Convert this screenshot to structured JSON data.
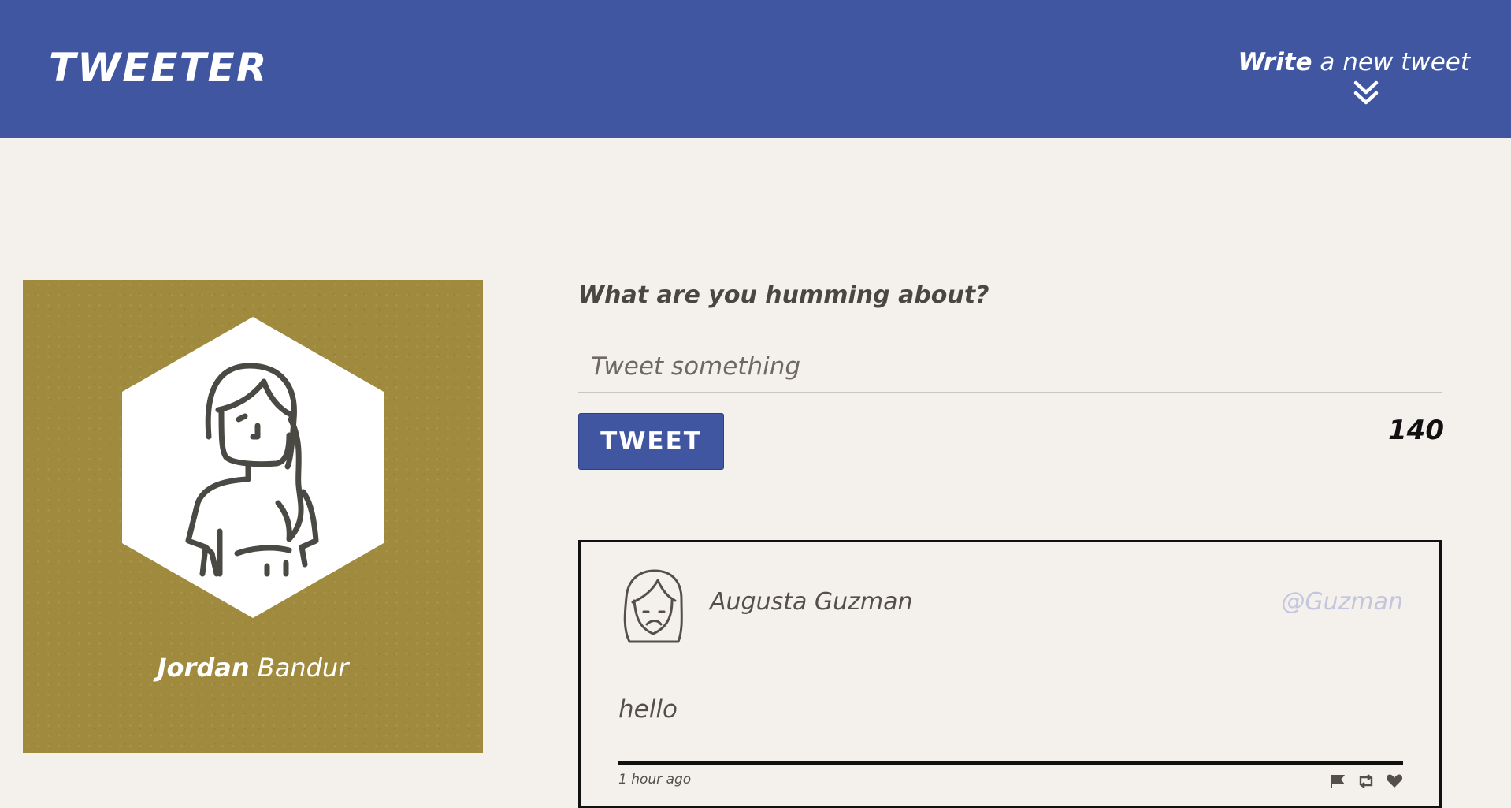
{
  "header": {
    "brand": "TWEETER",
    "compose_toggle_bold": "Write",
    "compose_toggle_rest": " a new tweet",
    "compose_toggle_icon": "double-chevron-down-icon"
  },
  "profile": {
    "first_name": "Jordan",
    "last_name": " Bandur",
    "avatar_icon": "woman-avatar-icon",
    "background_color": "#a08a3e"
  },
  "composer": {
    "prompt": "What are you humming about?",
    "input_placeholder": "Tweet something",
    "input_value": "",
    "submit_label": "TWEET",
    "char_counter": "140"
  },
  "tweets": [
    {
      "author": "Augusta Guzman",
      "handle": "@Guzman",
      "avatar_icon": "girl-avatar-icon",
      "content": "hello",
      "timestamp": "1 hour ago",
      "actions": [
        "flag-icon",
        "retweet-icon",
        "heart-icon"
      ]
    }
  ],
  "colors": {
    "primary": "#4056a1",
    "page_background": "#f4f1ec",
    "profile_background": "#a08a3e",
    "handle": "#c4c5de",
    "text": "#545049"
  }
}
